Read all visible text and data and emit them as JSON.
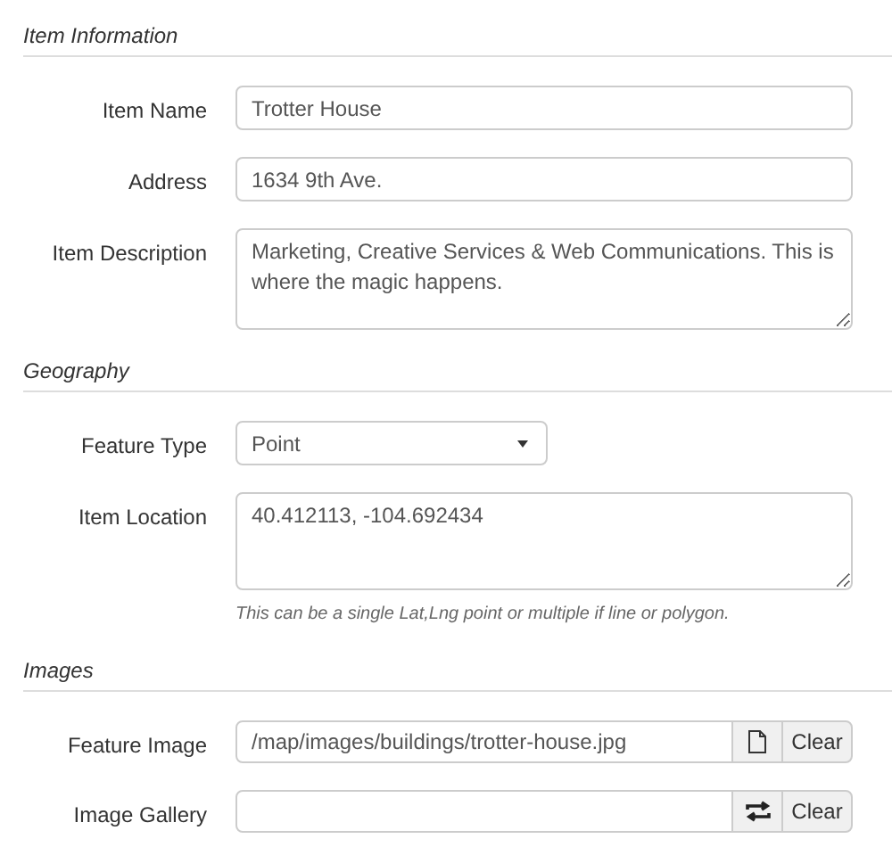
{
  "sections": [
    {
      "title": "Item Information",
      "fields": [
        {
          "kind": "text",
          "label": "Item Name",
          "value": "Trotter House"
        },
        {
          "kind": "text",
          "label": "Address",
          "value": "1634 9th Ave."
        },
        {
          "kind": "textarea",
          "label": "Item Description",
          "value": "Marketing, Creative Services & Web Communications. This is where the magic happens."
        }
      ]
    },
    {
      "title": "Geography",
      "fields": [
        {
          "kind": "select",
          "label": "Feature Type",
          "value": "Point"
        },
        {
          "kind": "textarea",
          "label": "Item Location",
          "value": "40.412113, -104.692434",
          "help": "This can be a single Lat,Lng point or multiple if line or polygon."
        }
      ]
    },
    {
      "title": "Images",
      "fields": [
        {
          "kind": "file",
          "label": "Feature Image",
          "value": "/map/images/buildings/trotter-house.jpg",
          "button": "Clear"
        },
        {
          "kind": "gallery",
          "label": "Image Gallery",
          "button": "Clear"
        }
      ]
    }
  ]
}
